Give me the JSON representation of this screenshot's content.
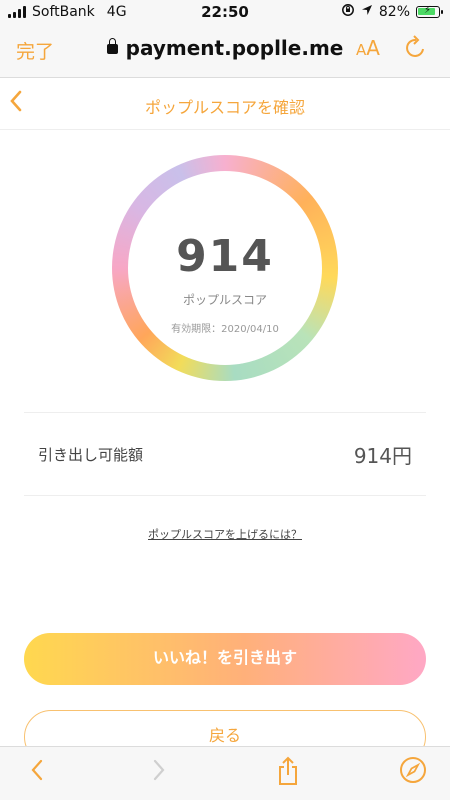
{
  "status_bar": {
    "carrier": "SoftBank",
    "network": "4G",
    "time": "22:50",
    "battery_percent": "82%",
    "battery_level": 0.82,
    "icons": [
      "signal-icon",
      "orientation-lock-icon",
      "location-icon",
      "battery-charging-icon"
    ]
  },
  "browser": {
    "done_label": "完了",
    "url": "payment.popl​le.me",
    "text_size_label_small": "A",
    "text_size_label_large": "A",
    "reload_icon": "reload-icon",
    "lock_icon": "lock-icon"
  },
  "page": {
    "title": "ポップルスコアを確認",
    "back_icon": "chevron-left-icon"
  },
  "score": {
    "value": "914",
    "label": "ポップルスコア",
    "expiry": "有効期限：2020/04/10"
  },
  "withdrawable": {
    "label": "引き出し可能額",
    "value": "914円"
  },
  "link": {
    "raise_score": "ポップルスコアを上げるには？"
  },
  "buttons": {
    "withdraw": "いいね！を引き出す",
    "back": "戻る"
  },
  "toolbar": {
    "icons": [
      "back-arrow-icon",
      "forward-arrow-icon",
      "share-icon",
      "compass-icon"
    ]
  },
  "colors": {
    "accent": "#f5a63c",
    "button_gradient_start": "#ffd84f",
    "button_gradient_end": "#ffa8c5"
  }
}
